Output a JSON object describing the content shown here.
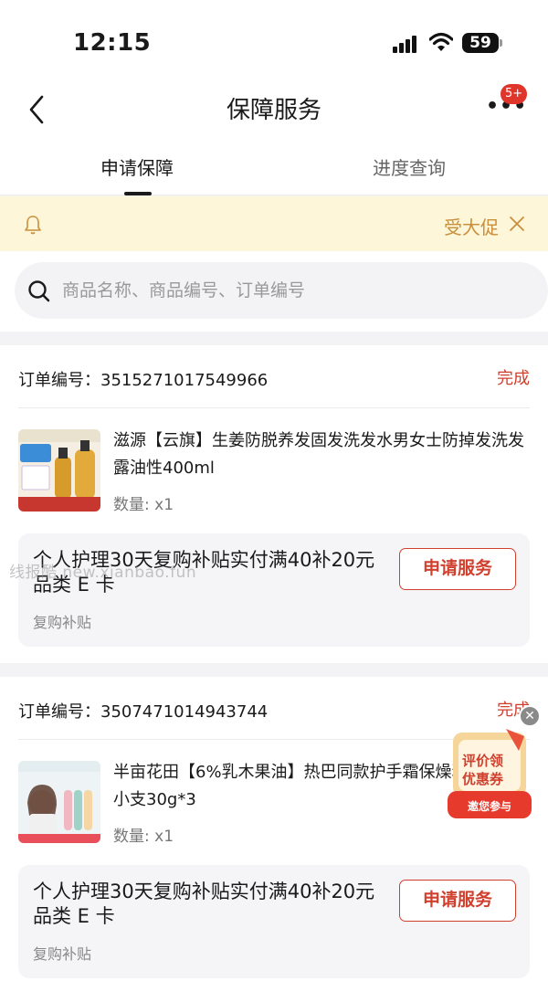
{
  "status": {
    "time": "12:15",
    "battery": "59"
  },
  "nav": {
    "title": "保障服务",
    "more_badge": "5+"
  },
  "tabs": [
    {
      "label": "申请保障",
      "active": true
    },
    {
      "label": "进度查询",
      "active": false
    }
  ],
  "notice": {
    "text": "受大促"
  },
  "search": {
    "placeholder": "商品名称、商品编号、订单编号"
  },
  "orders": [
    {
      "order_no": "订单编号：3515271017549966",
      "status": "完成",
      "product_name": "滋源【云旗】生姜防脱养发固发洗发水男女士防掉发洗发露油性400ml",
      "quantity": "数量: x1",
      "service_title": "个人护理30天复购补贴实付满40补20元品类 E 卡",
      "service_sub": "复购补贴",
      "button": "申请服务"
    },
    {
      "order_no": "订单编号：3507471014943744",
      "status": "完成",
      "product_name": "半亩花田【6%乳木果油】热巴同款护手霜保燥粗糙便携小支30g*3",
      "quantity": "数量: x1",
      "service_title": "个人护理30天复购补贴实付满40补20元品类 E 卡",
      "service_sub": "复购补贴",
      "button": "申请服务"
    }
  ],
  "watermark": "线报酷 new.xianbao.fun",
  "promo": {
    "line1": "评价领",
    "line2": "优惠券",
    "cta": "邀您参与"
  },
  "colors": {
    "accent": "#d0402f",
    "notice_bg": "#fdf6d8",
    "notice_text": "#c98f3c"
  }
}
